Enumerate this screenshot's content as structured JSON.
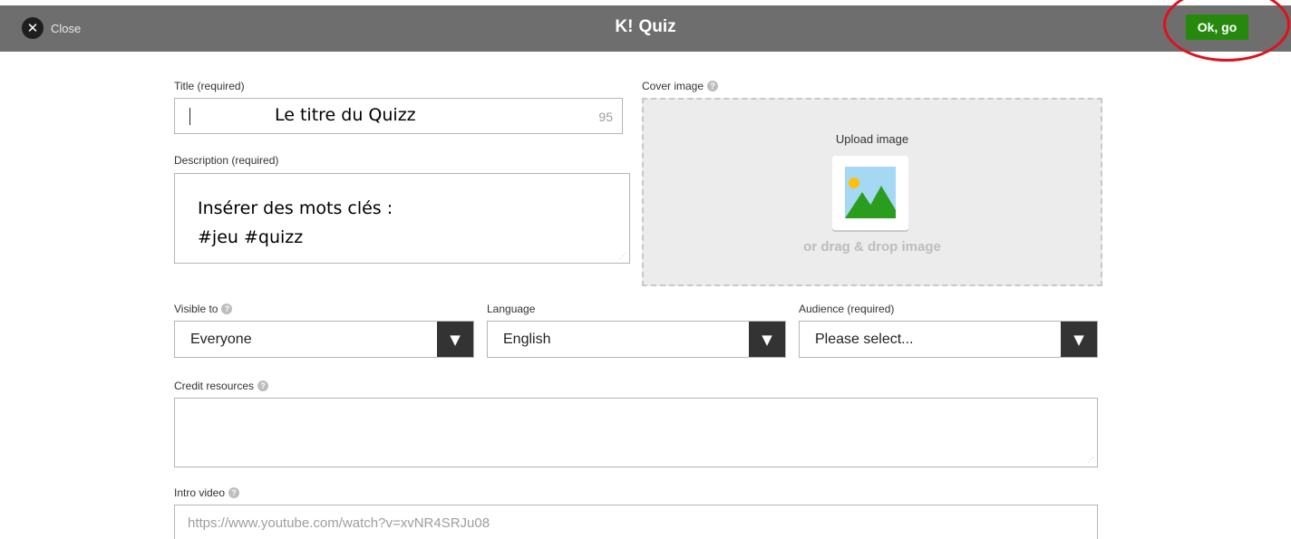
{
  "header": {
    "close_label": "Close",
    "close_icon": "close-icon",
    "brand_logo": "K!",
    "brand_title": "Quiz",
    "ok_label": "Ok, go"
  },
  "form": {
    "title": {
      "label": "Title (required)",
      "value": "Le titre du Quizz",
      "char_count": "95"
    },
    "description": {
      "label": "Description (required)",
      "lines": [
        "Insérer des mots clés :",
        "#jeu #quizz"
      ]
    },
    "cover": {
      "label": "Cover image",
      "upload_label": "Upload image",
      "drag_label": "or drag & drop image"
    },
    "visible_to": {
      "label": "Visible to",
      "value": "Everyone"
    },
    "language": {
      "label": "Language",
      "value": "English"
    },
    "audience": {
      "label": "Audience (required)",
      "value": "Please select..."
    },
    "credit": {
      "label": "Credit resources",
      "value": ""
    },
    "intro_video": {
      "label": "Intro video",
      "placeholder": "https://www.youtube.com/watch?v=xvNR4SRJu08"
    }
  },
  "colors": {
    "topbar": "#6e6e6e",
    "ok_button": "#26890c",
    "highlight": "#e0101e",
    "select_arrow_bg": "#333333"
  }
}
